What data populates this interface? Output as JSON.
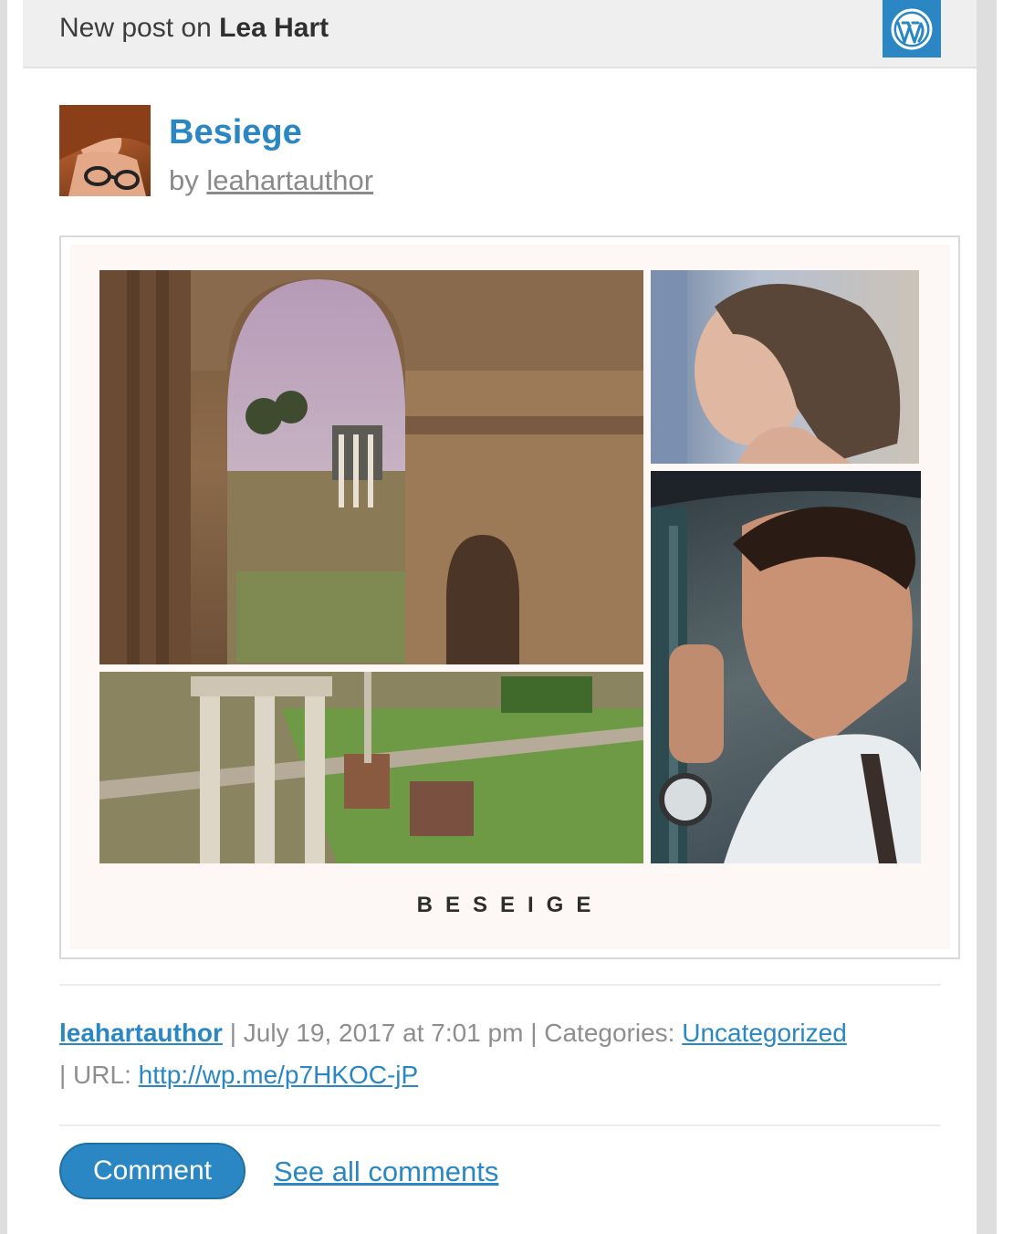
{
  "header": {
    "prefix": "New post on",
    "site_name": "Lea Hart",
    "logo_icon": "wordpress-logo-icon"
  },
  "post": {
    "title": "Besiege",
    "by_label": "by",
    "author": "leahartauthor",
    "image_caption": "BESEIGE"
  },
  "meta": {
    "author_link": "leahartauthor",
    "date": "| July 19, 2017 at 7:01 pm | Categories:",
    "category": "Uncategorized",
    "url_label": "| URL:",
    "url": "http://wp.me/p7HKOC-jP"
  },
  "actions": {
    "comment_label": "Comment",
    "see_all_label": "See all comments"
  },
  "colors": {
    "accent": "#2a87c3",
    "header_bg": "#efefef",
    "meta_text": "#8e8e8e"
  }
}
